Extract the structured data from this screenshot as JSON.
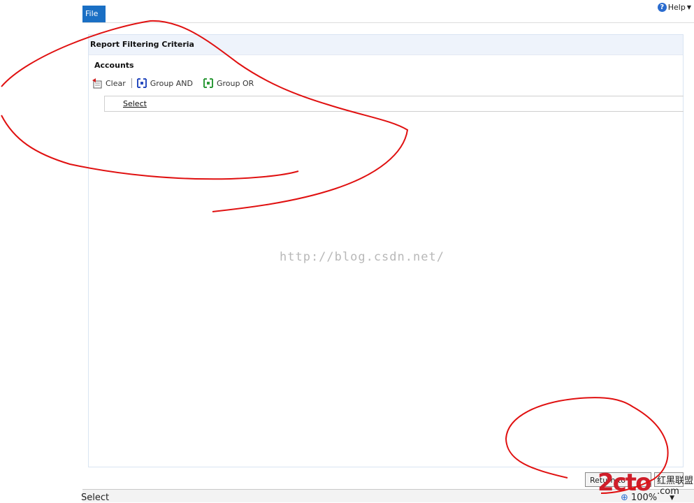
{
  "app": {
    "file_label": "File",
    "help_label": "Help",
    "help_glyph": "?"
  },
  "panel": {
    "header": "Report Filtering Criteria",
    "section_title": "Accounts",
    "toolbar": [
      {
        "label": "Clear",
        "icon": "clear-icon"
      },
      {
        "label": "Group AND",
        "icon": "group-and-icon"
      },
      {
        "label": "Group OR",
        "icon": "group-or-icon"
      }
    ],
    "select_link": "Select"
  },
  "watermark": "http://blog.csdn.net/",
  "footer": {
    "return_button": "Return to Report",
    "status_text": "Select",
    "zoom": "100%"
  },
  "branding": {
    "logo": "2cto",
    "suffix": ".com",
    "extra": "红黑联盟"
  },
  "colors": {
    "accent": "#1a6fc4",
    "scribble": "#e01010",
    "panel_header_bg": "#eef3fb"
  }
}
